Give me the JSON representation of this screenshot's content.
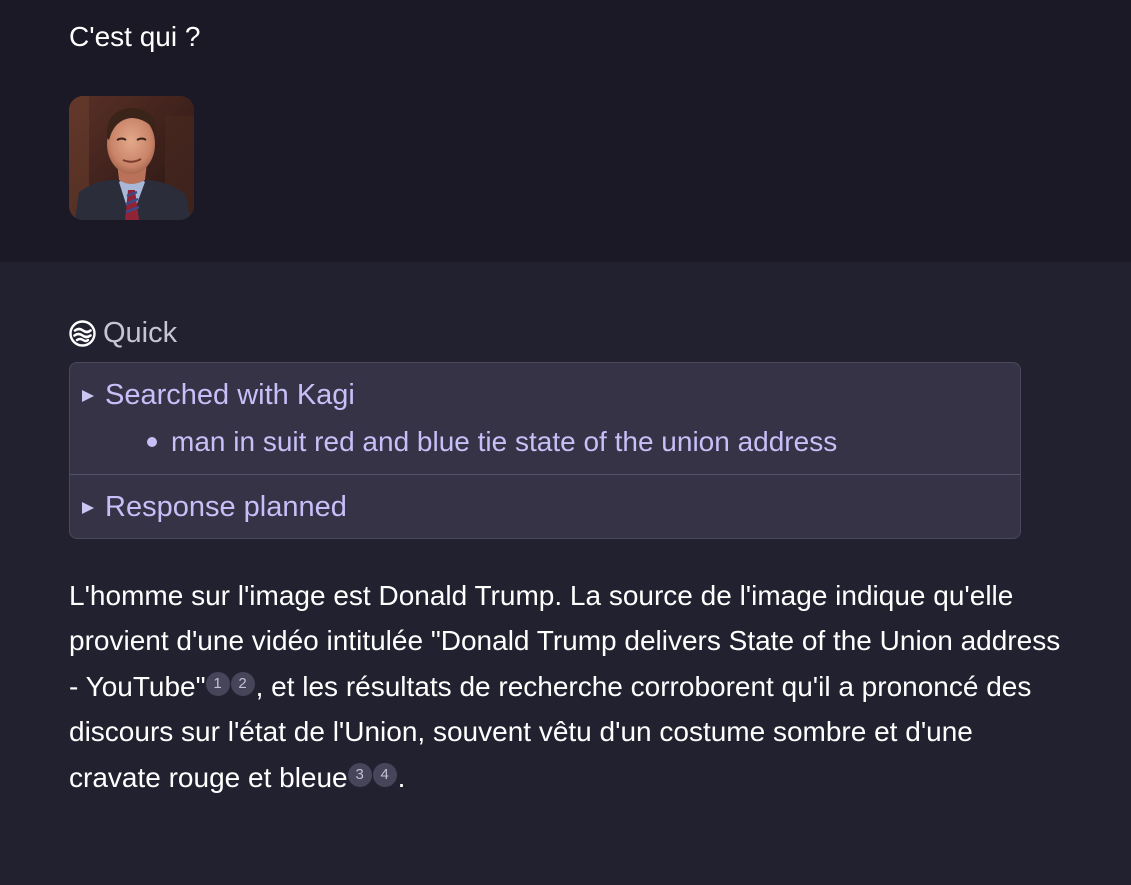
{
  "user_message": {
    "question": "C'est qui ?",
    "image_alt": "man in suit with red and blue tie"
  },
  "assistant": {
    "mode_label": "Quick",
    "steps": [
      {
        "title": "Searched with Kagi",
        "details": [
          "man in suit red and blue tie state of the union address"
        ]
      },
      {
        "title": "Response planned",
        "details": []
      }
    ],
    "answer": {
      "seg1": "L'homme sur l'image est Donald Trump. La source de l'image indique qu'elle provient d'une vidéo intitulée \"Donald Trump delivers State of the Union address - YouTube\"",
      "cite1": "1",
      "cite2": "2",
      "seg2": ", et les résultats de recherche corroborent qu'il a prononcé des discours sur l'état de l'Union, souvent vêtu d'un costume sombre et d'une cravate rouge et bleue",
      "cite3": "3",
      "cite4": "4",
      "seg3": "."
    }
  },
  "colors": {
    "user_bg": "#1a1925",
    "assistant_bg": "#22212f",
    "accent": "#c7bff7",
    "box_bg": "#353345"
  }
}
